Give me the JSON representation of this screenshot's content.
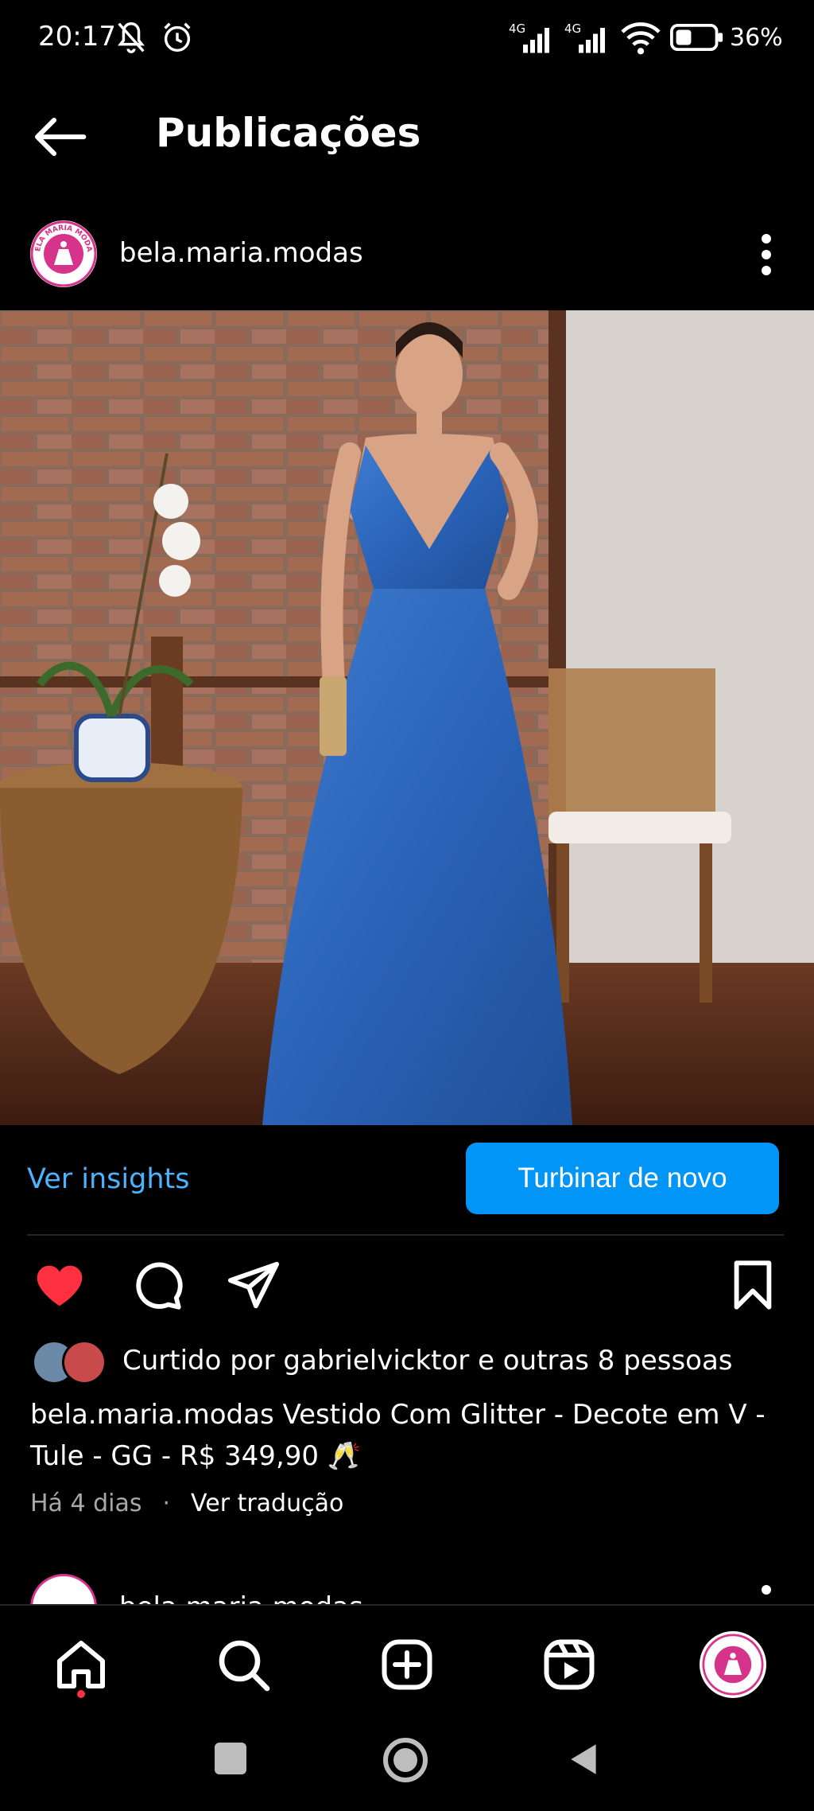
{
  "status_bar": {
    "time": "20:17",
    "signal1_label": "4G",
    "signal2_label": "4G",
    "battery_percent": "36%"
  },
  "header": {
    "title": "Publicações"
  },
  "post": {
    "username": "bela.maria.modas",
    "avatar_text": "BELA MARIA MODAS",
    "insights_label": "Ver insights",
    "boost_label": "Turbinar de novo",
    "liked_by": "Curtido por gabrielvicktor e outras 8 pessoas",
    "caption_user": "bela.maria.modas",
    "caption_text": "Vestido Com Glitter - Decote em V - Tule - GG - R$ 349,90 🥂",
    "time_ago": "Há 4 dias",
    "separator": "·",
    "translate_label": "Ver tradução",
    "liked": true
  },
  "next_post": {
    "username": "bela.maria.modas"
  },
  "colors": {
    "accent": "#0095f6",
    "link": "#4cb4ff",
    "like": "#ff3040",
    "brand_pink": "#d6338a"
  }
}
